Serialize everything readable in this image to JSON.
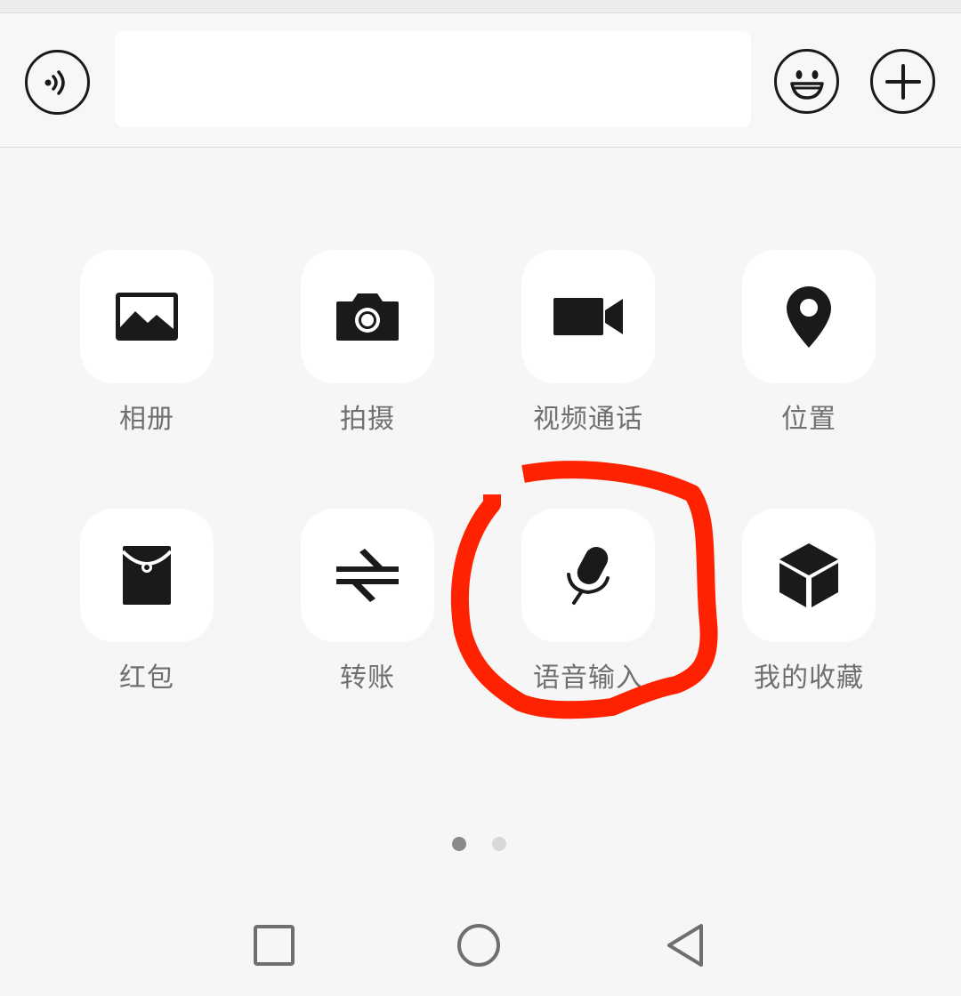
{
  "input_bar": {
    "text_value": "",
    "voice_icon": "voice-wave-icon",
    "emoji_icon": "emoji-smile-icon",
    "plus_icon": "plus-icon"
  },
  "actions": [
    {
      "label": "相册",
      "icon": "photo-album-icon"
    },
    {
      "label": "拍摄",
      "icon": "camera-icon"
    },
    {
      "label": "视频通话",
      "icon": "video-call-icon"
    },
    {
      "label": "位置",
      "icon": "location-pin-icon"
    },
    {
      "label": "红包",
      "icon": "red-packet-icon"
    },
    {
      "label": "转账",
      "icon": "transfer-arrows-icon"
    },
    {
      "label": "语音输入",
      "icon": "microphone-icon"
    },
    {
      "label": "我的收藏",
      "icon": "favorites-cube-icon"
    }
  ],
  "pagination": {
    "current_page": 1,
    "total_pages": 2
  },
  "annotation": {
    "shape": "hand-drawn circle",
    "color": "#ff2200",
    "target": "语音输入"
  },
  "navbar": {
    "recent_icon": "square-icon",
    "home_icon": "circle-icon",
    "back_icon": "triangle-back-icon"
  },
  "colors": {
    "background": "#f6f6f6",
    "tile": "#ffffff",
    "icon": "#1a1a1a",
    "label": "#6f6f6f"
  }
}
